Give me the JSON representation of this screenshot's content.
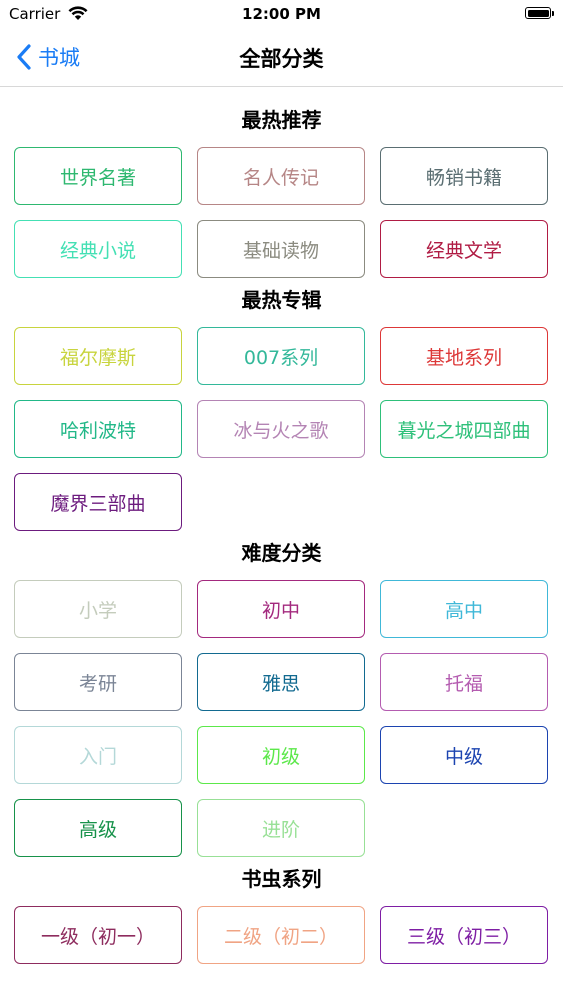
{
  "status_bar": {
    "carrier": "Carrier",
    "time": "12:00 PM"
  },
  "nav": {
    "back_label": "书城",
    "title": "全部分类",
    "back_color": "#1a7cf5"
  },
  "sections": [
    {
      "title": "最热推荐",
      "tags": [
        {
          "label": "世界名著",
          "color": "#2eb870"
        },
        {
          "label": "名人传记",
          "color": "#b68686"
        },
        {
          "label": "畅销书籍",
          "color": "#5a6e72"
        },
        {
          "label": "经典小说",
          "color": "#44e0b4"
        },
        {
          "label": "基础读物",
          "color": "#8b8b80"
        },
        {
          "label": "经典文学",
          "color": "#b01c44"
        }
      ]
    },
    {
      "title": "最热专辑",
      "tags": [
        {
          "label": "福尔摩斯",
          "color": "#c8d43e"
        },
        {
          "label": "007系列",
          "color": "#33b89a"
        },
        {
          "label": "基地系列",
          "color": "#dd3838"
        },
        {
          "label": "哈利波特",
          "color": "#22b888"
        },
        {
          "label": "冰与火之歌",
          "color": "#b484b4"
        },
        {
          "label": "暮光之城四部曲",
          "color": "#2ec07a"
        },
        {
          "label": "魔界三部曲",
          "color": "#6c1b7e"
        }
      ]
    },
    {
      "title": "难度分类",
      "tags": [
        {
          "label": "小学",
          "color": "#c4ccbc"
        },
        {
          "label": "初中",
          "color": "#a3297e"
        },
        {
          "label": "高中",
          "color": "#40b8d8"
        },
        {
          "label": "考研",
          "color": "#7b8596"
        },
        {
          "label": "雅思",
          "color": "#126a90"
        },
        {
          "label": "托福",
          "color": "#b45cb0"
        },
        {
          "label": "入门",
          "color": "#b4d8d8"
        },
        {
          "label": "初级",
          "color": "#5ce84a"
        },
        {
          "label": "中级",
          "color": "#1c44b0"
        },
        {
          "label": "高级",
          "color": "#17924a"
        },
        {
          "label": "进阶",
          "color": "#98e096"
        }
      ]
    },
    {
      "title": "书虫系列",
      "tags": [
        {
          "label": "一级（初一）",
          "color": "#8e2c5e"
        },
        {
          "label": "二级（初二）",
          "color": "#f0a484"
        },
        {
          "label": "三级（初三）",
          "color": "#7e1ea4"
        }
      ]
    }
  ]
}
